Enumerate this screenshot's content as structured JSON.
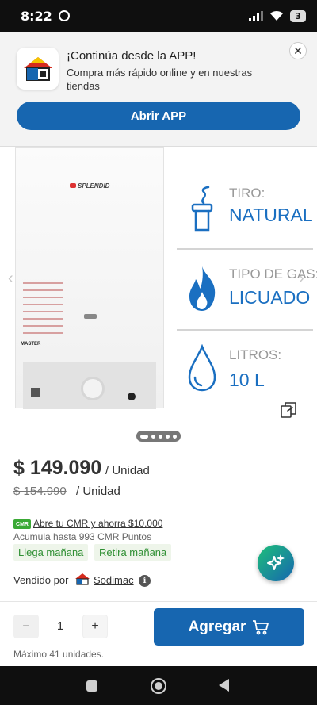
{
  "status_bar": {
    "time": "8:22",
    "battery": "3"
  },
  "banner": {
    "title": "¡Continúa desde la APP!",
    "subtitle": "Compra más rápido online y en nuestras tiendas",
    "open_button": "Abrir APP",
    "close_symbol": "✕"
  },
  "gallery": {
    "brand_label": "SPLENDID",
    "model_label": "MASTER",
    "specs": [
      {
        "icon": "chimney-icon",
        "label": "TIRO:",
        "value": "NATURAL"
      },
      {
        "icon": "flame-icon",
        "label": "TIPO DE GAS:",
        "value": "LICUADO"
      },
      {
        "icon": "water-drop-icon",
        "label": "LITROS:",
        "value": "10 L"
      }
    ],
    "prev_arrow": "‹",
    "next_arrow": "›"
  },
  "pricing": {
    "price": "$ 149.090",
    "price_unit": "/ Unidad",
    "old_price": "$ 154.990",
    "old_unit": "/ Unidad"
  },
  "cmr": {
    "badge": "CMR",
    "link": "Abre tu CMR y ahorra $10.000",
    "points": "Acumula hasta 993 CMR Puntos"
  },
  "delivery": {
    "chip_1": "Llega mañana",
    "chip_2": "Retira mañana"
  },
  "seller": {
    "label": "Vendido por",
    "name": "Sodimac",
    "info": "i"
  },
  "cart": {
    "minus": "−",
    "quantity": "1",
    "plus": "+",
    "add_button": "Agregar",
    "max_note": "Máximo 41 unidades."
  },
  "colors": {
    "brand_blue": "#1766b0",
    "spec_blue": "#1a6fc1",
    "green": "#3aa935"
  }
}
